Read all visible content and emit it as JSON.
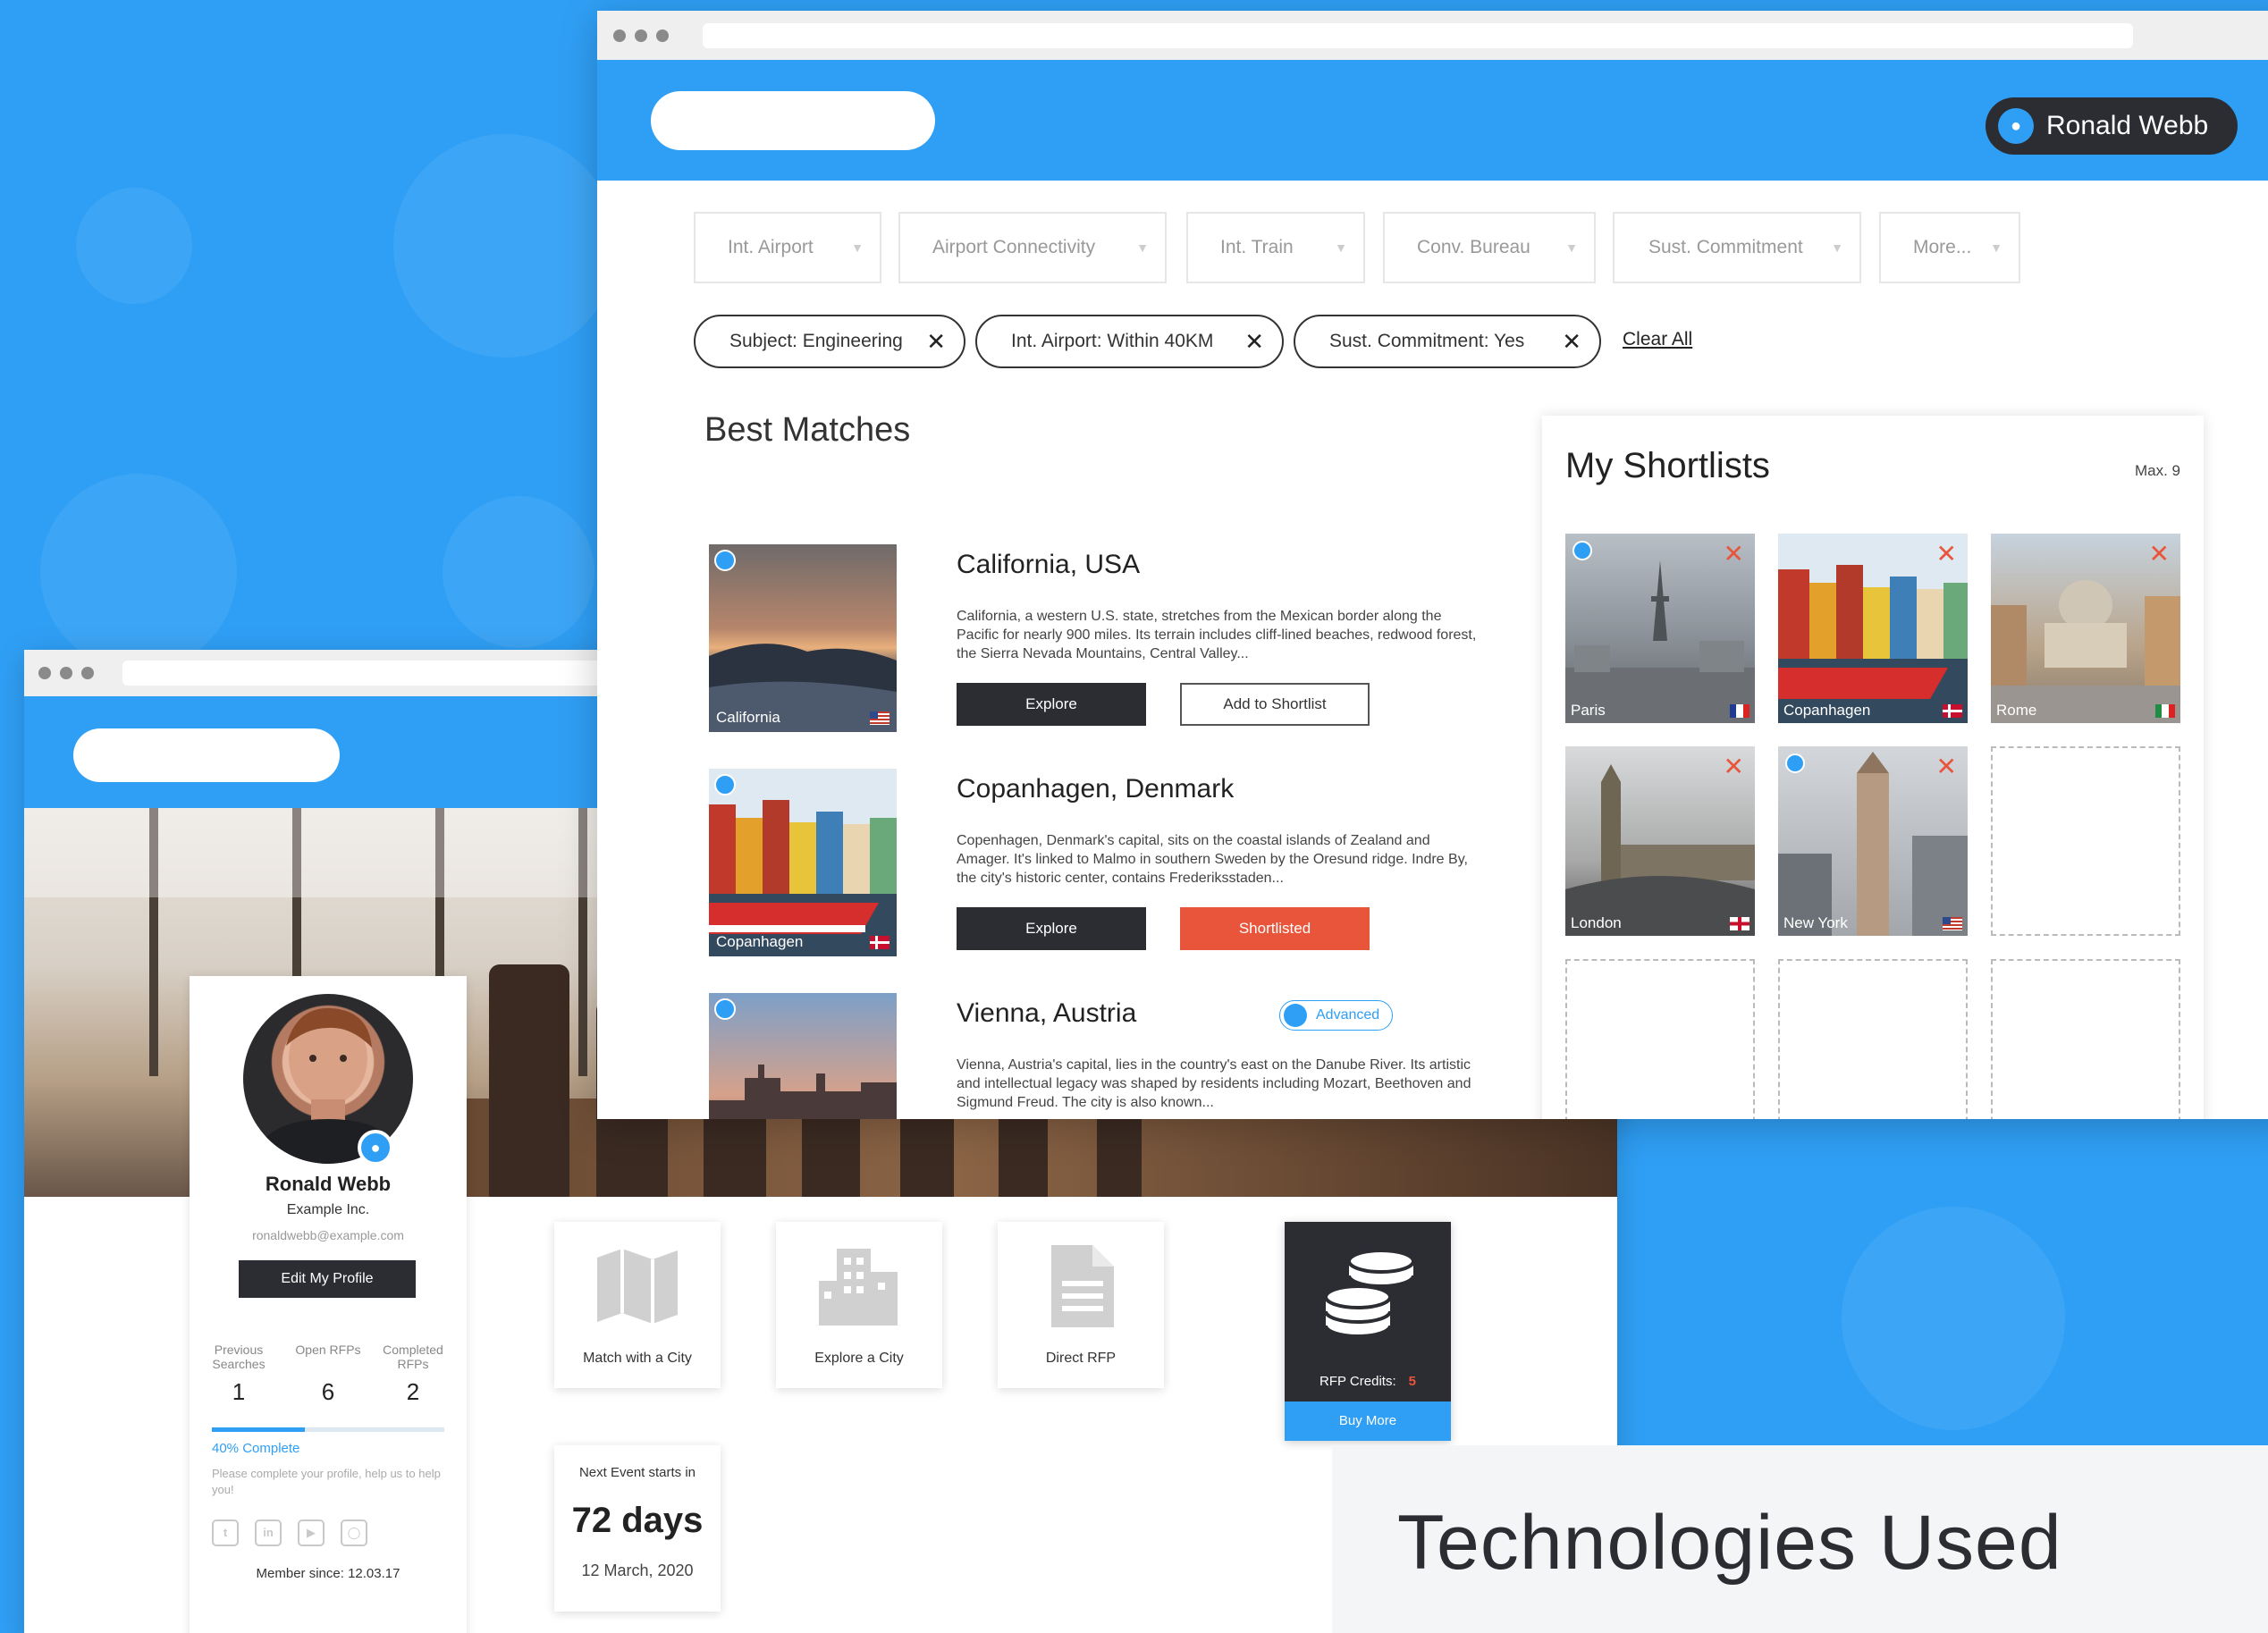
{
  "front_window": {
    "user_name": "Ronald Webb",
    "filters": [
      {
        "label": "Int. Airport"
      },
      {
        "label": "Airport Connectivity"
      },
      {
        "label": "Int. Train"
      },
      {
        "label": "Conv. Bureau"
      },
      {
        "label": "Sust. Commitment"
      },
      {
        "label": "More..."
      }
    ],
    "active_filters": [
      {
        "label": "Subject: Engineering"
      },
      {
        "label": "Int. Airport: Within 40KM"
      },
      {
        "label": "Sust. Commitment: Yes"
      }
    ],
    "clear_all": "Clear All",
    "best_matches": {
      "title": "Best Matches",
      "items": [
        {
          "title": "California, USA",
          "thumb_label": "California",
          "description": "California, a western U.S. state, stretches from the Mexican border along the Pacific for nearly 900 miles. Its terrain includes cliff-lined beaches, redwood forest, the Sierra Nevada Mountains, Central Valley...",
          "explore_label": "Explore",
          "shortlist_label": "Add to Shortlist"
        },
        {
          "title": "Copanhagen, Denmark",
          "thumb_label": "Copanhagen",
          "description": "Copenhagen, Denmark's capital, sits on the coastal islands of Zealand and Amager. It's linked to Malmo in southern Sweden by the Oresund ridge. Indre By, the city's historic center, contains Frederiksstaden...",
          "explore_label": "Explore",
          "shortlist_label": "Shortlisted"
        },
        {
          "title": "Vienna, Austria",
          "badge": "Advanced",
          "description": "Vienna, Austria's capital, lies in the country's east on the Danube River. Its artistic and intellectual legacy was shaped by residents including Mozart, Beethoven and Sigmund Freud. The city is also known..."
        }
      ]
    },
    "shortlists": {
      "title": "My Shortlists",
      "max_label": "Max. 9",
      "slots": [
        {
          "label": "Paris"
        },
        {
          "label": "Copanhagen"
        },
        {
          "label": "Rome"
        },
        {
          "label": "London"
        },
        {
          "label": "New York"
        }
      ]
    }
  },
  "profile": {
    "name": "Ronald Webb",
    "company": "Example Inc.",
    "email": "ronaldwebb@example.com",
    "edit_label": "Edit My Profile",
    "stats": [
      {
        "label": "Previous Searches",
        "value": "1"
      },
      {
        "label": "Open RFPs",
        "value": "6"
      },
      {
        "label": "Completed RFPs",
        "value": "2"
      }
    ],
    "progress_text": "40% Complete",
    "progress_value": 0.4,
    "hint": "Please complete your profile, help us to help you!",
    "member_since": "Member since: 12.03.17"
  },
  "dashboard": {
    "tiles": [
      {
        "label": "Match with a City",
        "icon": "map-icon"
      },
      {
        "label": "Explore a City",
        "icon": "buildings-icon"
      },
      {
        "label": "Direct RFP",
        "icon": "document-icon"
      }
    ],
    "rfp_credits_label": "RFP Credits:",
    "rfp_credits_value": "5",
    "buy_more_label": "Buy More",
    "next_event_label": "Next Event starts in",
    "next_event_days": "72 days",
    "next_event_date": "12 March, 2020"
  },
  "caption": "Technologies Used",
  "colors": {
    "accent": "#2f9ff5",
    "dark": "#2b2d33",
    "danger": "#e8553b"
  }
}
